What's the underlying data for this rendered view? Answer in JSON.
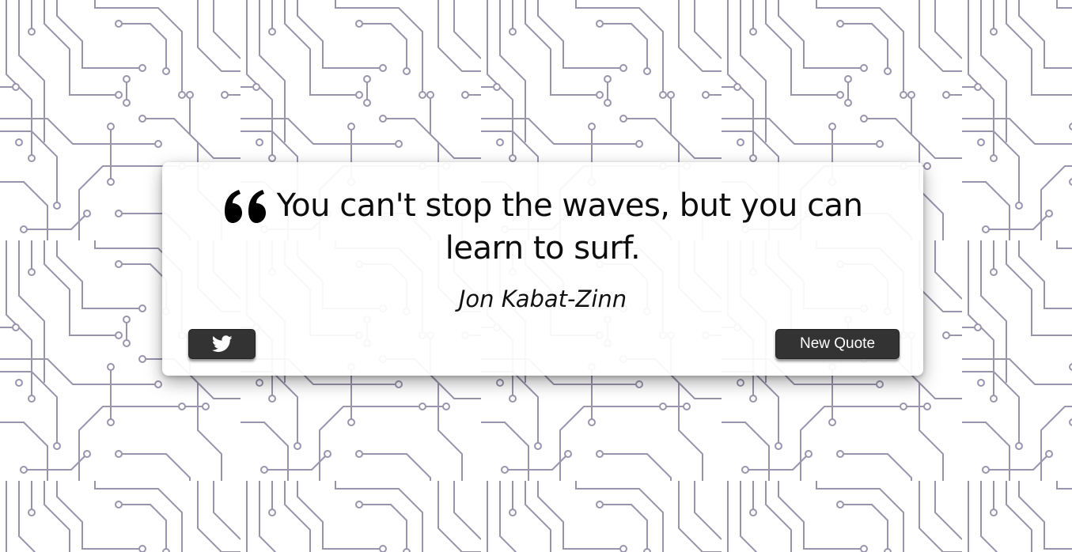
{
  "quote": {
    "text": "You can't stop the waves, but you can learn to surf.",
    "author": "Jon Kabat-Zinn"
  },
  "buttons": {
    "tweet_icon": "twitter-icon",
    "new_quote_label": "New Quote"
  },
  "colors": {
    "background": "#ffffff",
    "circuit_line": "#9a93ac",
    "button_bg": "#333333",
    "button_text": "#ffffff",
    "text": "#0c0c0c"
  }
}
